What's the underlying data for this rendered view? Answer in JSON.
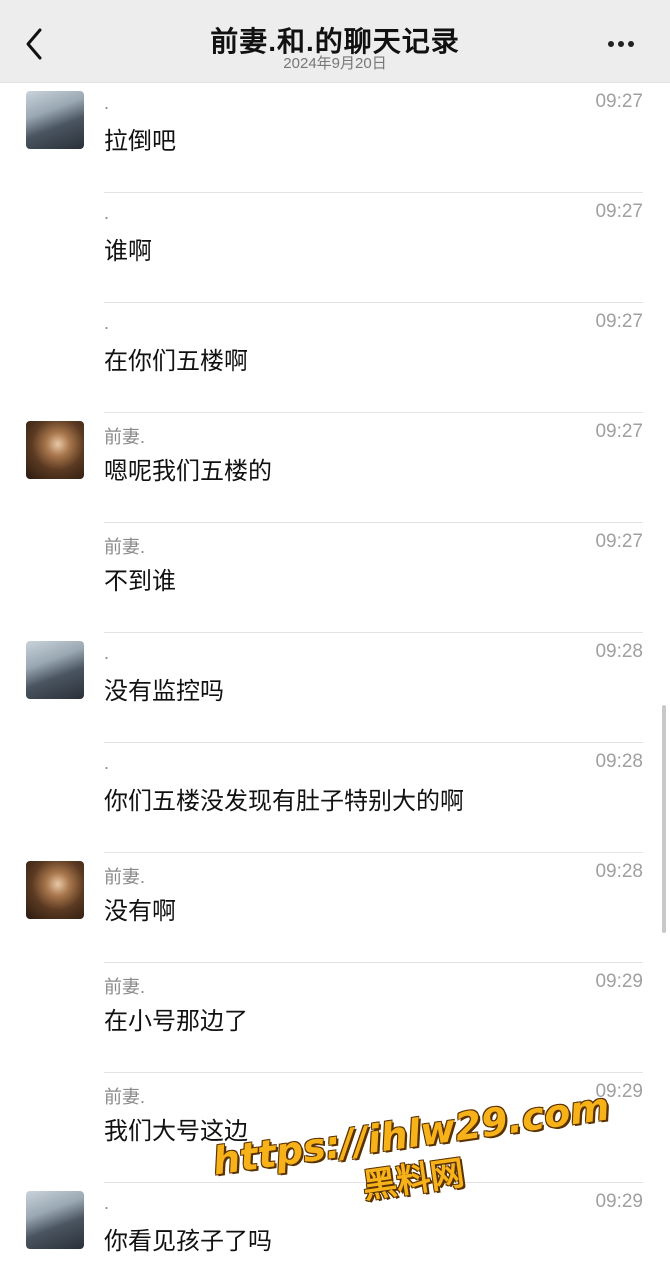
{
  "header": {
    "title": "前妻.和.的聊天记录",
    "subtitle": "2024年9月20日"
  },
  "messages": [
    {
      "sender": ".",
      "time": "09:27",
      "text": "拉倒吧",
      "avatar": "car"
    },
    {
      "sender": ".",
      "time": "09:27",
      "text": "谁啊",
      "avatar": ""
    },
    {
      "sender": ".",
      "time": "09:27",
      "text": "在你们五楼啊",
      "avatar": ""
    },
    {
      "sender": "前妻.",
      "time": "09:27",
      "text": "嗯呢我们五楼的",
      "avatar": "woman"
    },
    {
      "sender": "前妻.",
      "time": "09:27",
      "text": "不到谁",
      "avatar": ""
    },
    {
      "sender": ".",
      "time": "09:28",
      "text": "没有监控吗",
      "avatar": "car"
    },
    {
      "sender": ".",
      "time": "09:28",
      "text": "你们五楼没发现有肚子特别大的啊",
      "avatar": ""
    },
    {
      "sender": "前妻.",
      "time": "09:28",
      "text": "没有啊",
      "avatar": "woman"
    },
    {
      "sender": "前妻.",
      "time": "09:29",
      "text": "在小号那边了",
      "avatar": ""
    },
    {
      "sender": "前妻.",
      "time": "09:29",
      "text": "我们大号这边",
      "avatar": ""
    },
    {
      "sender": ".",
      "time": "09:29",
      "text": "你看见孩子了吗",
      "avatar": "car"
    }
  ],
  "watermark": {
    "url": "https://ihlw29.com",
    "label": "黑料网"
  },
  "colors": {
    "header_bg": "#ededed",
    "watermark": "#f7b21a"
  },
  "icons": {
    "back": "chevron-left-icon",
    "more": "more-dots-icon"
  }
}
